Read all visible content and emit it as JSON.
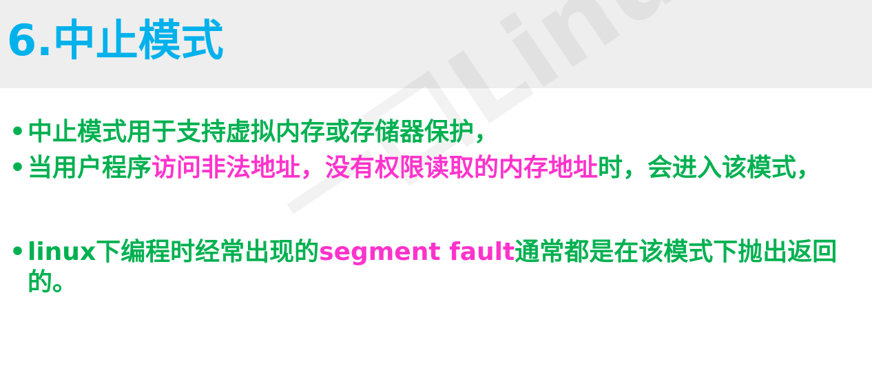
{
  "slide": {
    "title": "6.中止模式",
    "watermark": "一口Linux",
    "bullet_char": "•",
    "bullets": [
      {
        "parts": [
          {
            "text": "中止模式用于支持虚拟内存或存储器保护，"
          }
        ]
      },
      {
        "parts": [
          {
            "text": "当用户程序"
          },
          {
            "text": "访问非法地址，没有权限读取的内存地址"
          },
          {
            "text": "时，会进入该模式，"
          }
        ]
      },
      {
        "parts": [
          {
            "text": "linux下编程时经常出现的"
          },
          {
            "text": "segment fault"
          },
          {
            "text": "通常都是在该模式下抛出返回的。"
          }
        ]
      }
    ]
  },
  "colors": {
    "title": "#00b1eb",
    "text": "#00b050",
    "highlight": "#ff33cc",
    "title_bar_bg": "#eeeeee"
  }
}
